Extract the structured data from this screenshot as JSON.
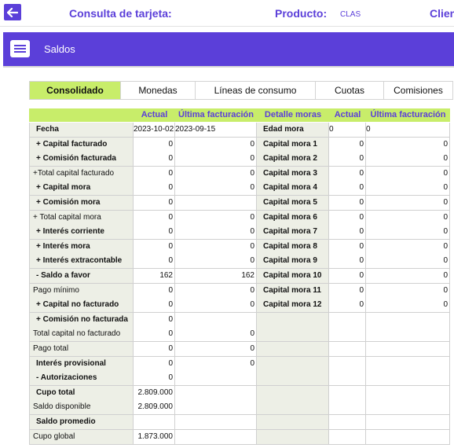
{
  "topbar": {
    "card_label": "Consulta de tarjeta:",
    "product_label": "Producto:",
    "product_value": "CLAS",
    "client_label": "Clien"
  },
  "header": {
    "title": "Saldos",
    "icon": "list-card-icon"
  },
  "tabs": [
    "Consolidado",
    "Monedas",
    "Líneas de consumo",
    "Cuotas",
    "Comisiones"
  ],
  "active_tab": "Consolidado",
  "left_table": {
    "headers": [
      "",
      "Actual",
      "Última facturación"
    ],
    "rows": [
      {
        "label": "Fecha",
        "actual": "2023-10-02",
        "ultima": "2023-09-15",
        "bold": true
      },
      {
        "label": "+ Capital facturado",
        "actual": "0",
        "ultima": "0",
        "bold": true
      },
      {
        "label": "+ Comisión facturada",
        "actual": "0",
        "ultima": "0",
        "bold": true
      },
      {
        "label": "+Total capital facturado",
        "actual": "0",
        "ultima": "0",
        "bold": false
      },
      {
        "label": "+ Capital mora",
        "actual": "0",
        "ultima": "0",
        "bold": true
      },
      {
        "label": "+ Comisión mora",
        "actual": "0",
        "ultima": "",
        "bold": true
      },
      {
        "label": "+ Total capital mora",
        "actual": "0",
        "ultima": "0",
        "bold": false
      },
      {
        "label": "+ Interés corriente",
        "actual": "0",
        "ultima": "0",
        "bold": true
      },
      {
        "label": "+ Interés mora",
        "actual": "0",
        "ultima": "0",
        "bold": true
      },
      {
        "label": "+ Interés extracontable",
        "actual": "0",
        "ultima": "0",
        "bold": true
      },
      {
        "label": "- Saldo a favor",
        "actual": "162",
        "ultima": "162",
        "bold": true
      },
      {
        "label": "Pago mínimo",
        "actual": "0",
        "ultima": "0",
        "bold": false
      },
      {
        "label": "+ Capital no facturado",
        "actual": "0",
        "ultima": "0",
        "bold": true
      },
      {
        "label": "+ Comisión no facturada",
        "actual": "0",
        "ultima": "",
        "bold": true
      },
      {
        "label": "Total capital no facturado",
        "actual": "0",
        "ultima": "0",
        "bold": false
      },
      {
        "label": "Pago total",
        "actual": "0",
        "ultima": "0",
        "bold": false
      },
      {
        "label": "Interés provisional",
        "actual": "0",
        "ultima": "0",
        "bold": true
      },
      {
        "label": "- Autorizaciones",
        "actual": "0",
        "ultima": "",
        "bold": true
      },
      {
        "label": "Cupo total",
        "actual": "2.809.000",
        "ultima": "",
        "bold": true
      },
      {
        "label": "Saldo disponible",
        "actual": "2.809.000",
        "ultima": "",
        "bold": false
      },
      {
        "label": "Saldo promedio",
        "actual": "",
        "ultima": "",
        "bold": true
      },
      {
        "label": "Cupo global",
        "actual": "1.873.000",
        "ultima": "",
        "bold": false
      }
    ]
  },
  "right_table": {
    "headers": [
      "Detalle moras",
      "Actual",
      "Última facturación"
    ],
    "rows": [
      {
        "label": "Edad mora",
        "actual": "0",
        "ultima": "0"
      },
      {
        "label": "Capital mora 1",
        "actual": "0",
        "ultima": "0"
      },
      {
        "label": "Capital mora 2",
        "actual": "0",
        "ultima": "0"
      },
      {
        "label": "Capital mora 3",
        "actual": "0",
        "ultima": "0"
      },
      {
        "label": "Capital mora 4",
        "actual": "0",
        "ultima": "0"
      },
      {
        "label": "Capital mora 5",
        "actual": "0",
        "ultima": "0"
      },
      {
        "label": "Capital mora 6",
        "actual": "0",
        "ultima": "0"
      },
      {
        "label": "Capital mora 7",
        "actual": "0",
        "ultima": "0"
      },
      {
        "label": "Capital mora 8",
        "actual": "0",
        "ultima": "0"
      },
      {
        "label": "Capital mora 9",
        "actual": "0",
        "ultima": "0"
      },
      {
        "label": "Capital mora 10",
        "actual": "0",
        "ultima": "0"
      },
      {
        "label": "Capital mora 11",
        "actual": "0",
        "ultima": "0"
      },
      {
        "label": "Capital mora 12",
        "actual": "0",
        "ultima": "0"
      }
    ]
  },
  "colors": {
    "accent": "#5b3fd9",
    "highlight": "#c8ed6a",
    "label_bg": "#edefe6"
  }
}
